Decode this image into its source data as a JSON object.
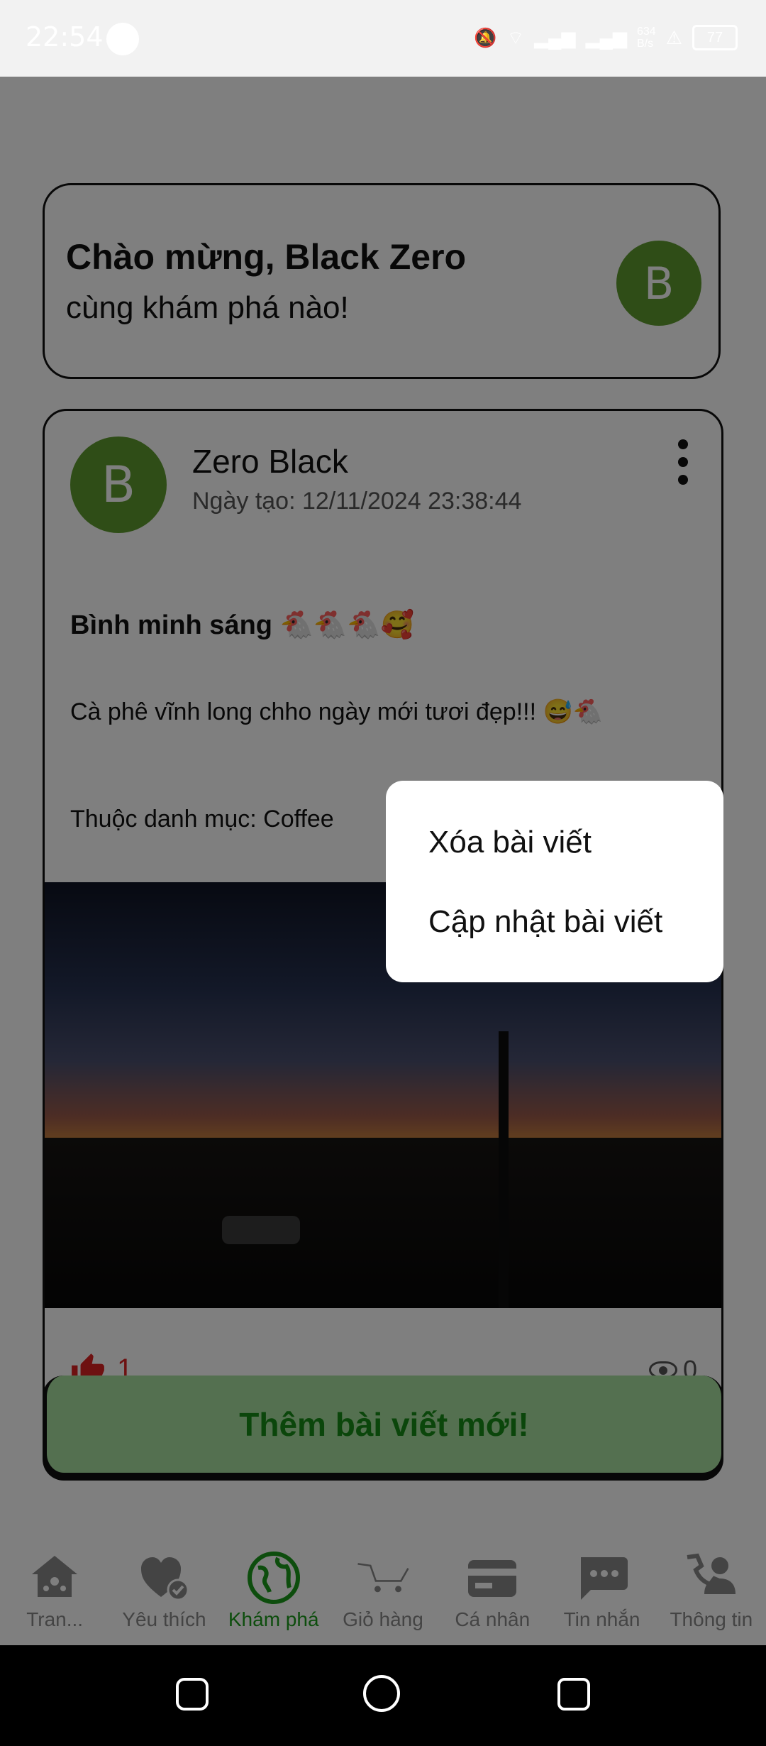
{
  "status_bar": {
    "time": "22:54",
    "net_speed_top": "634",
    "net_speed_bottom": "B/s",
    "battery": "77"
  },
  "welcome": {
    "title": "Chào mừng, Black Zero",
    "subtitle": "cùng khám phá nào!",
    "avatar_letter": "B"
  },
  "post": {
    "avatar_letter": "B",
    "author": "Zero Black",
    "date": "Ngày tạo: 12/11/2024 23:38:44",
    "title": "Bình minh sáng 🐔🐔🐔🥰",
    "body": "Cà phê vĩnh long chho ngày mới tươi đẹp!!! 😅🐔",
    "category": "Thuộc danh mục: Coffee",
    "likes": "1",
    "views": "0"
  },
  "add_button": {
    "label": "Thêm bài viết mới!"
  },
  "popup_menu": {
    "items": [
      "Xóa bài viết",
      "Cập nhật bài viết"
    ]
  },
  "bottom_nav": {
    "items": [
      {
        "label": "Tran...",
        "icon": "home-network-icon"
      },
      {
        "label": "Yêu thích",
        "icon": "favorite-check-icon"
      },
      {
        "label": "Khám phá",
        "icon": "globe-icon",
        "active": true
      },
      {
        "label": "Giỏ hàng",
        "icon": "cart-icon"
      },
      {
        "label": "Cá nhân",
        "icon": "card-icon"
      },
      {
        "label": "Tin nhắn",
        "icon": "message-icon"
      },
      {
        "label": "Thông tin",
        "icon": "person-phone-icon"
      }
    ]
  },
  "colors": {
    "accent_green": "#1a9a1a",
    "avatar_green": "#5e9b2f",
    "like_red": "#dd2222",
    "button_bg": "#a8e0a0"
  }
}
